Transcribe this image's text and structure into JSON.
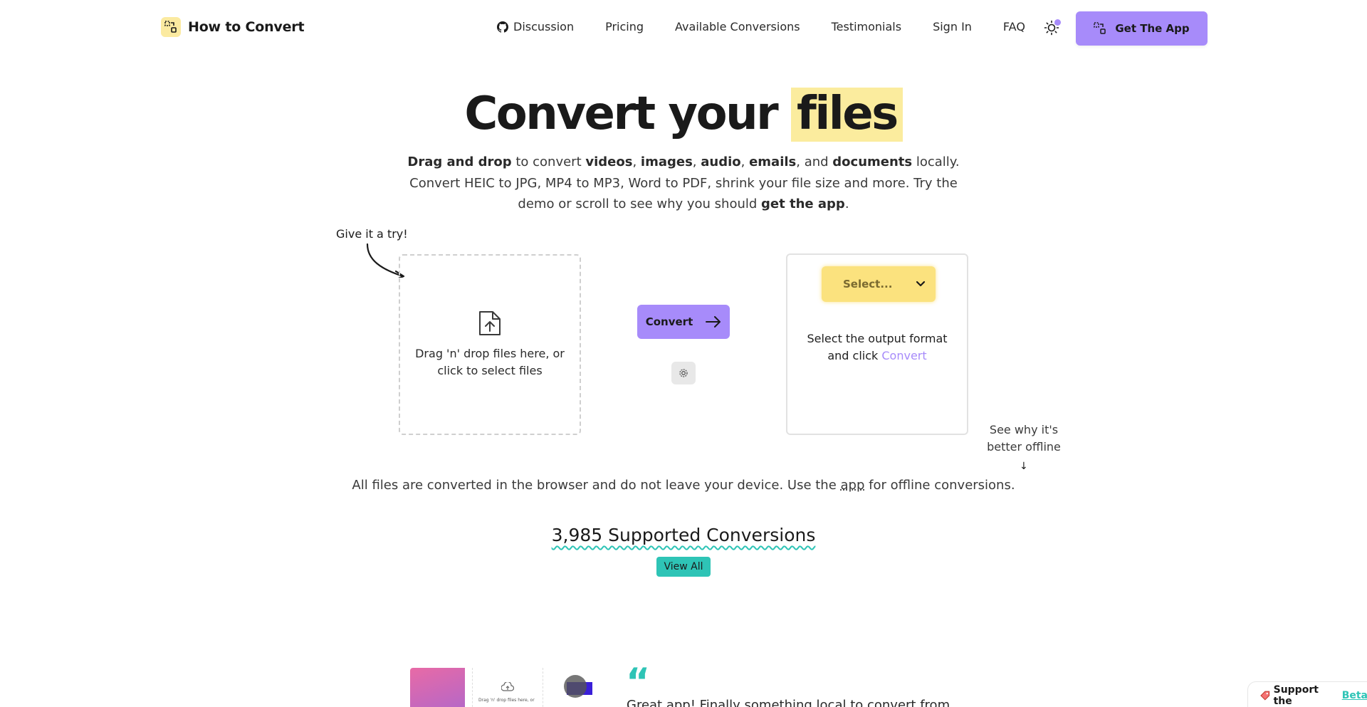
{
  "brand": {
    "name": "How to Convert",
    "logo_icon": "convert-logo-icon"
  },
  "nav": {
    "discussion": "Discussion",
    "pricing": "Pricing",
    "conversions": "Available Conversions",
    "testimonials": "Testimonials",
    "signin": "Sign In",
    "faq": "FAQ",
    "get_app": "Get The App"
  },
  "hero": {
    "title_a": "Convert your ",
    "title_b": "files",
    "sub": {
      "p1": "Drag and drop",
      "p2": " to convert ",
      "p3": "videos",
      "p4": ", ",
      "p5": "images",
      "p6": ", ",
      "p7": "audio",
      "p8": ", ",
      "p9": "emails",
      "p10": ", and ",
      "p11": "documents",
      "p12": " locally. Convert HEIC to JPG, MP4 to MP3, Word to PDF, shrink your file size and more. Try the demo or scroll to see why you should ",
      "p13": "get the app",
      "p14": "."
    }
  },
  "demo": {
    "try_label": "Give it a try!",
    "drop_text": "Drag 'n' drop files here, or click to select files",
    "convert_label": "Convert",
    "select_placeholder": "Select...",
    "output_text": "Select the output format and click ",
    "output_convert": "Convert",
    "offline_note": "See why it's better offline",
    "offline_arrow": "↓"
  },
  "notes": {
    "browser_a": "All files are converted in the browser and do not leave your device. Use the ",
    "browser_link": "app",
    "browser_b": " for offline conversions.",
    "supported": "3,985 Supported Conversions",
    "view_all": "View All"
  },
  "testimonial": {
    "quote_mark": "“",
    "text": "Great app! Finally something local to convert from",
    "preview_drop_text": "Drag 'n' drop files here, or"
  },
  "beta": {
    "a": "Support the ",
    "link": "Beta"
  },
  "colors": {
    "accent": "#a78bfa",
    "highlight": "#fbec9e",
    "select": "#fbe27e",
    "teal": "#2ec4b6"
  }
}
